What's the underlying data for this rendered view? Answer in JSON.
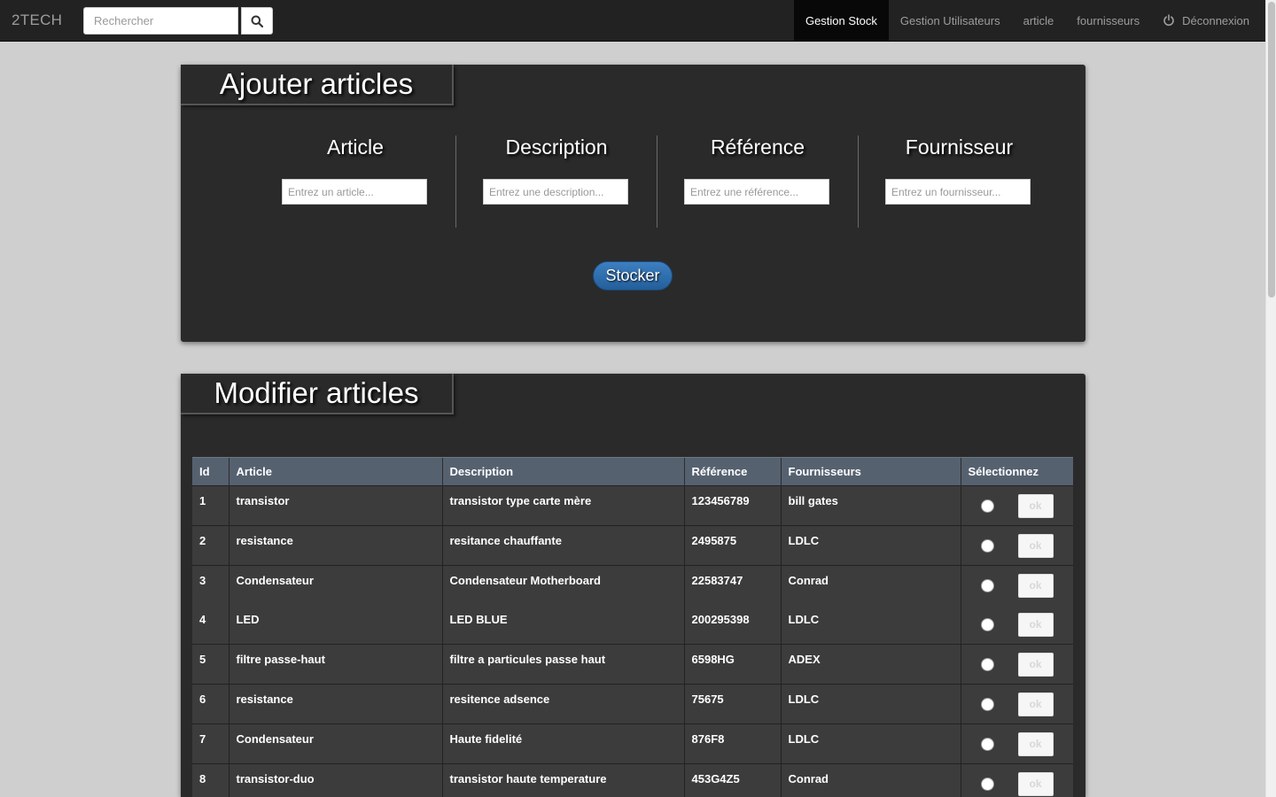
{
  "navbar": {
    "brand": "2TECH",
    "search_placeholder": "Rechercher",
    "items": [
      {
        "label": "Gestion Stock",
        "active": true
      },
      {
        "label": "Gestion Utilisateurs"
      },
      {
        "label": "article"
      },
      {
        "label": "fournisseurs"
      },
      {
        "label": "Déconnexion",
        "icon": "power-icon"
      }
    ]
  },
  "add_panel": {
    "title": "Ajouter articles",
    "fields": [
      {
        "label": "Article",
        "placeholder": "Entrez un article..."
      },
      {
        "label": "Description",
        "placeholder": "Entrez une description..."
      },
      {
        "label": "Référence",
        "placeholder": "Entrez une référence..."
      },
      {
        "label": "Fournisseur",
        "placeholder": "Entrez un fournisseur..."
      }
    ],
    "submit_label": "Stocker"
  },
  "edit_panel": {
    "title": "Modifier articles",
    "columns": [
      "Id",
      "Article",
      "Description",
      "Référence",
      "Fournisseurs",
      "Sélectionnez"
    ],
    "ok_label": "ok",
    "rows": [
      {
        "id": "1",
        "article": "transistor",
        "description": "transistor type carte mère",
        "reference": "123456789",
        "fournisseur": "bill gates"
      },
      {
        "id": "2",
        "article": "resistance",
        "description": "resitance chauffante",
        "reference": "2495875",
        "fournisseur": "LDLC"
      },
      {
        "id": "3",
        "article": "Condensateur",
        "description": "Condensateur Motherboard",
        "reference": "22583747",
        "fournisseur": "Conrad"
      },
      {
        "id": "4",
        "article": "LED",
        "description": "LED BLUE",
        "reference": "200295398",
        "fournisseur": "LDLC"
      },
      {
        "id": "5",
        "article": "filtre passe-haut",
        "description": "filtre a particules passe haut",
        "reference": "6598HG",
        "fournisseur": "ADEX"
      },
      {
        "id": "6",
        "article": "resistance",
        "description": "resitence adsence",
        "reference": "75675",
        "fournisseur": "LDLC"
      },
      {
        "id": "7",
        "article": "Condensateur",
        "description": "Haute fidelité",
        "reference": "876F8",
        "fournisseur": "LDLC"
      },
      {
        "id": "8",
        "article": "transistor-duo",
        "description": "transistor haute temperature",
        "reference": "453G4Z5",
        "fournisseur": "Conrad"
      }
    ]
  },
  "colors": {
    "navbar": "#222222",
    "panel": "#2a2a2a",
    "table_header": "#566170",
    "accent_button": "#2d6eae"
  }
}
